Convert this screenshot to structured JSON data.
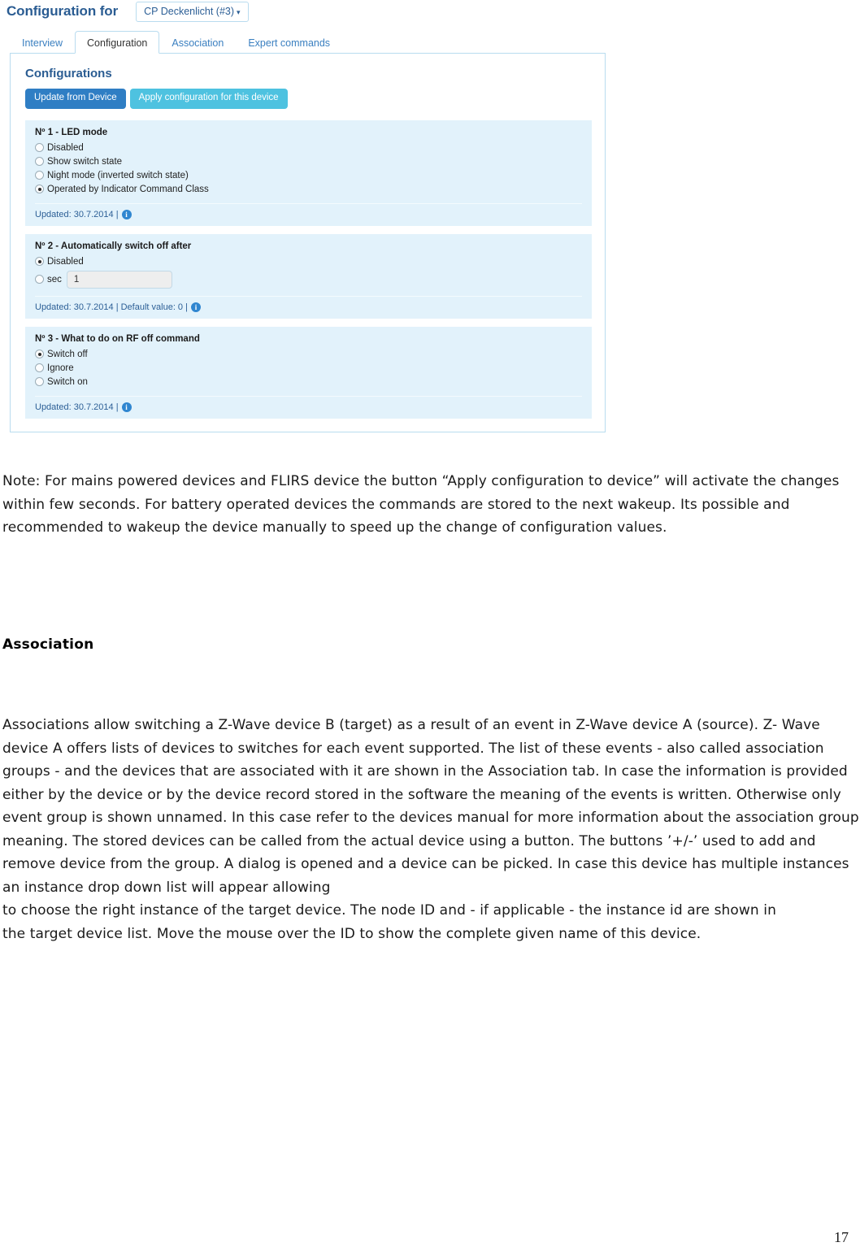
{
  "screenshot": {
    "header": {
      "title": "Configuration for",
      "device_selector": {
        "label": "CP Deckenlicht (#3)",
        "caret": "▾"
      }
    },
    "tabs": [
      {
        "label": "Interview",
        "active": false
      },
      {
        "label": "Configuration",
        "active": true
      },
      {
        "label": "Association",
        "active": false
      },
      {
        "label": "Expert commands",
        "active": false
      }
    ],
    "panel": {
      "heading": "Configurations",
      "buttons": {
        "update": "Update from Device",
        "apply": "Apply configuration for this device"
      },
      "colors": {
        "update_button": "#2f7ec4",
        "apply_button": "#4ec2e0",
        "block_background": "#e2f2fb",
        "border": "#b9dcef",
        "heading_text": "#2a5c92"
      },
      "blocks": [
        {
          "title": "Nº 1 - LED mode",
          "options": [
            {
              "label": "Disabled",
              "selected": false
            },
            {
              "label": "Show switch state",
              "selected": false
            },
            {
              "label": "Night mode (inverted switch state)",
              "selected": false
            },
            {
              "label": "Operated by Indicator Command Class",
              "selected": true
            }
          ],
          "footer": "Updated: 30.7.2014 |",
          "info_icon": "i"
        },
        {
          "title": "Nº 2 - Automatically switch off after",
          "options": [
            {
              "label": "Disabled",
              "selected": true
            }
          ],
          "value_option": {
            "selected": false,
            "unit_label": "sec",
            "value": "1"
          },
          "footer": "Updated: 30.7.2014 | Default value: 0 |",
          "info_icon": "i"
        },
        {
          "title": "Nº 3 - What to do on RF off command",
          "options": [
            {
              "label": "Switch off",
              "selected": true
            },
            {
              "label": "Ignore",
              "selected": false
            },
            {
              "label": "Switch on",
              "selected": false
            }
          ],
          "footer": "Updated: 30.7.2014 |",
          "info_icon": "i"
        }
      ]
    }
  },
  "document": {
    "note_paragraph": "Note: For mains powered devices and FLIRS device the button “Apply configuration to device” will activate the changes within few seconds. For battery operated devices the commands are stored to the next wakeup. Its possible and recommended to wakeup the device manually to speed up the change of configuration values.",
    "association_heading": "Association",
    "association_body": "Associations allow switching a Z-Wave device B (target) as a result of an event in Z-Wave device A (source). Z- Wave device A offers lists of devices to switches for each event supported. The list of these events - also called association groups - and the devices that are associated with it are shown in the Association tab. In case the information is provided either by the device or by the device record stored in the software the meaning of the events is written. Otherwise only event group is shown unnamed. In this case refer to the devices manual for more information about the association group meaning. The stored devices can be called from the actual device using a button. The buttons ’+/-’ used to add and remove device from the group. A dialog is opened and a device can be picked. In case this device has multiple instances an instance drop down list will appear allowing\nto choose the right instance of the target device. The node ID and - if applicable - the instance id are shown in\nthe target device list. Move the mouse over the ID to show the complete given name of this device.",
    "page_number": "17"
  }
}
